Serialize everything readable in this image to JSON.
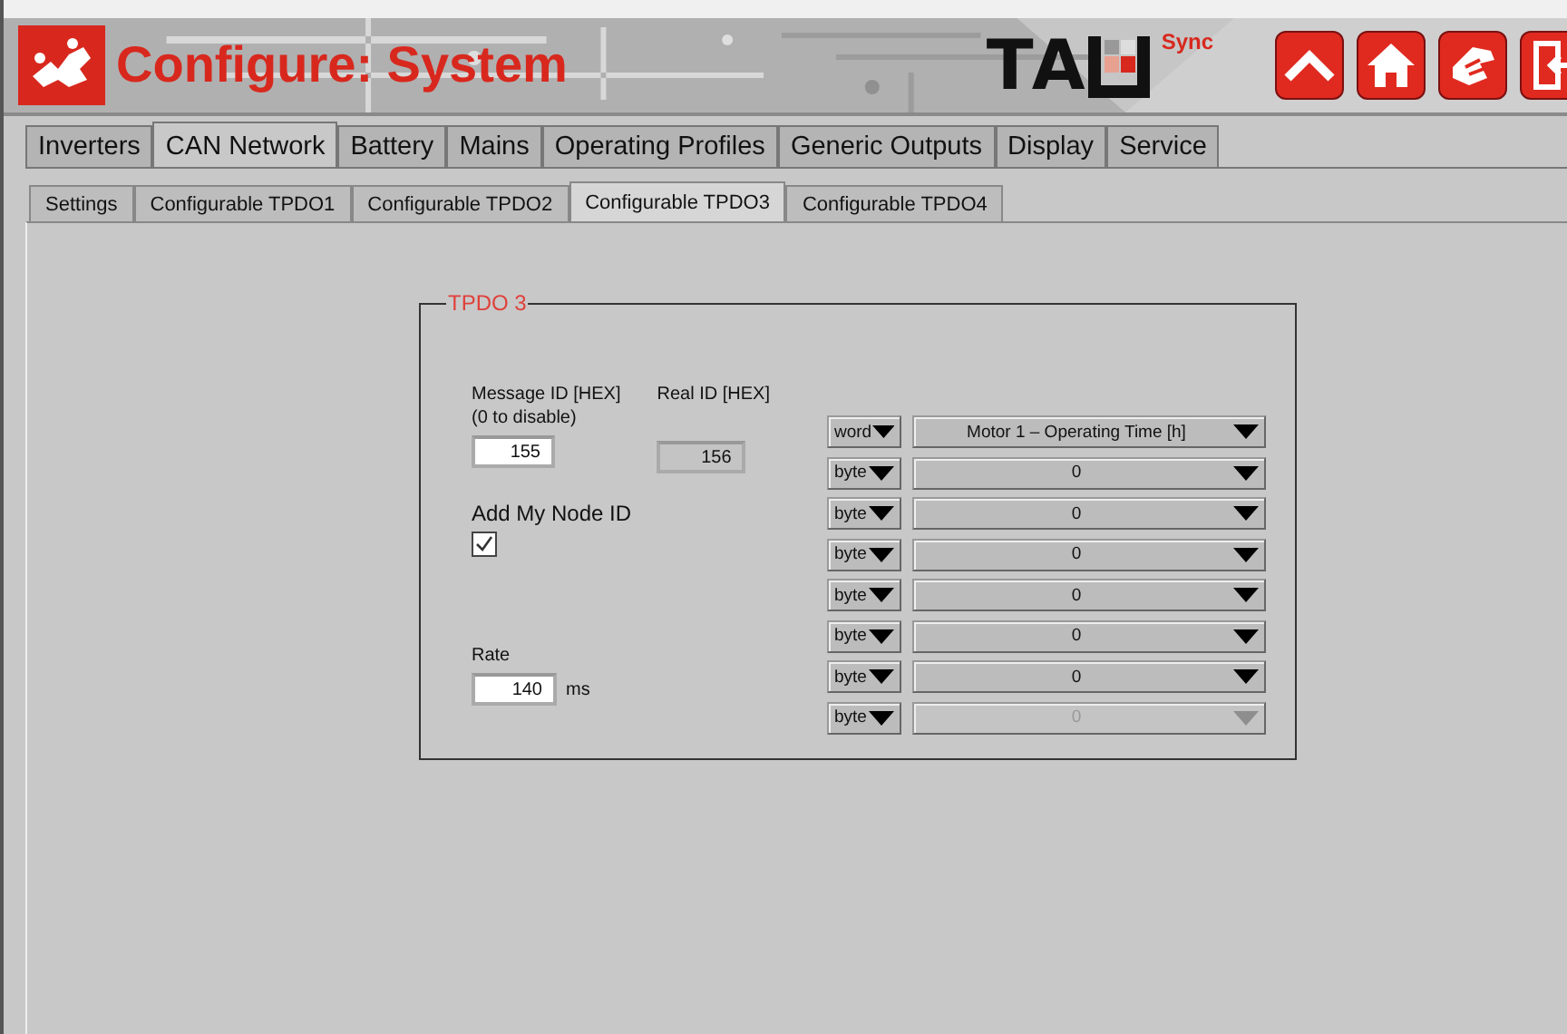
{
  "header": {
    "title": "Configure: System",
    "logo_text": "TA",
    "logo_suffix": "Sync"
  },
  "header_buttons": [
    {
      "kind": "up"
    },
    {
      "kind": "home"
    },
    {
      "kind": "hand"
    },
    {
      "kind": "exit"
    }
  ],
  "tabs": [
    {
      "label": "Inverters",
      "selected": false
    },
    {
      "label": "CAN Network",
      "selected": true
    },
    {
      "label": "Battery",
      "selected": false
    },
    {
      "label": "Mains",
      "selected": false
    },
    {
      "label": "Operating Profiles",
      "selected": false
    },
    {
      "label": "Generic Outputs",
      "selected": false
    },
    {
      "label": "Display",
      "selected": false
    },
    {
      "label": "Service",
      "selected": false
    }
  ],
  "subtabs": [
    {
      "label": "Settings",
      "selected": false
    },
    {
      "label": "Configurable TPDO1",
      "selected": false
    },
    {
      "label": "Configurable TPDO2",
      "selected": false
    },
    {
      "label": "Configurable TPDO3",
      "selected": true
    },
    {
      "label": "Configurable TPDO4",
      "selected": false
    }
  ],
  "group": {
    "title": "TPDO 3",
    "message_id": {
      "label": "Message ID [HEX]",
      "hint": "(0 to disable)",
      "value": "155"
    },
    "real_id": {
      "label": "Real ID [HEX]",
      "value": "156"
    },
    "add_node": {
      "label": "Add My Node ID",
      "checked": true
    },
    "rate": {
      "label": "Rate",
      "value": "140",
      "unit": "ms"
    },
    "mappings": [
      {
        "type": "word",
        "value": "Motor 1 – Operating Time [h]",
        "disabled": false
      },
      {
        "type": "byte",
        "value": "0",
        "disabled": false
      },
      {
        "type": "byte",
        "value": "0",
        "disabled": false
      },
      {
        "type": "byte",
        "value": "0",
        "disabled": false
      },
      {
        "type": "byte",
        "value": "0",
        "disabled": false
      },
      {
        "type": "byte",
        "value": "0",
        "disabled": false
      },
      {
        "type": "byte",
        "value": "0",
        "disabled": false
      },
      {
        "type": "byte",
        "value": "0",
        "disabled": true
      }
    ]
  }
}
